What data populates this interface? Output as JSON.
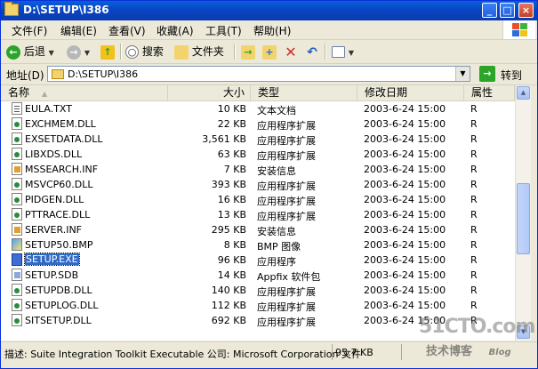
{
  "window": {
    "title": "D:\\SETUP\\I386"
  },
  "menu": [
    "文件(F)",
    "编辑(E)",
    "查看(V)",
    "收藏(A)",
    "工具(T)",
    "帮助(H)"
  ],
  "toolbar": {
    "back": "后退",
    "search": "搜索",
    "folders": "文件夹"
  },
  "address": {
    "label": "地址(D)",
    "path": "D:\\SETUP\\I386",
    "go": "转到"
  },
  "columns": {
    "name": "名称",
    "size": "大小",
    "type": "类型",
    "date": "修改日期",
    "attr": "属性"
  },
  "files": [
    {
      "name": "EULA.TXT",
      "size": "10 KB",
      "type": "文本文档",
      "date": "2003-6-24 15:00",
      "attr": "R",
      "icon": "txt"
    },
    {
      "name": "EXCHMEM.DLL",
      "size": "22 KB",
      "type": "应用程序扩展",
      "date": "2003-6-24 15:00",
      "attr": "R",
      "icon": "dll"
    },
    {
      "name": "EXSETDATA.DLL",
      "size": "3,561 KB",
      "type": "应用程序扩展",
      "date": "2003-6-24 15:00",
      "attr": "R",
      "icon": "dll"
    },
    {
      "name": "LIBXDS.DLL",
      "size": "63 KB",
      "type": "应用程序扩展",
      "date": "2003-6-24 15:00",
      "attr": "R",
      "icon": "dll"
    },
    {
      "name": "MSSEARCH.INF",
      "size": "7 KB",
      "type": "安装信息",
      "date": "2003-6-24 15:00",
      "attr": "R",
      "icon": "inf"
    },
    {
      "name": "MSVCP60.DLL",
      "size": "393 KB",
      "type": "应用程序扩展",
      "date": "2003-6-24 15:00",
      "attr": "R",
      "icon": "dll"
    },
    {
      "name": "PIDGEN.DLL",
      "size": "16 KB",
      "type": "应用程序扩展",
      "date": "2003-6-24 15:00",
      "attr": "R",
      "icon": "dll"
    },
    {
      "name": "PTTRACE.DLL",
      "size": "13 KB",
      "type": "应用程序扩展",
      "date": "2003-6-24 15:00",
      "attr": "R",
      "icon": "dll"
    },
    {
      "name": "SERVER.INF",
      "size": "295 KB",
      "type": "安装信息",
      "date": "2003-6-24 15:00",
      "attr": "R",
      "icon": "inf"
    },
    {
      "name": "SETUP50.BMP",
      "size": "8 KB",
      "type": "BMP 图像",
      "date": "2003-6-24 15:00",
      "attr": "R",
      "icon": "bmp"
    },
    {
      "name": "SETUP.EXE",
      "size": "96 KB",
      "type": "应用程序",
      "date": "2003-6-24 15:00",
      "attr": "R",
      "icon": "exe",
      "selected": true
    },
    {
      "name": "SETUP.SDB",
      "size": "14 KB",
      "type": "Appfix 软件包",
      "date": "2003-6-24 15:00",
      "attr": "R",
      "icon": "sdb"
    },
    {
      "name": "SETUPDB.DLL",
      "size": "140 KB",
      "type": "应用程序扩展",
      "date": "2003-6-24 15:00",
      "attr": "R",
      "icon": "dll"
    },
    {
      "name": "SETUPLOG.DLL",
      "size": "112 KB",
      "type": "应用程序扩展",
      "date": "2003-6-24 15:00",
      "attr": "R",
      "icon": "dll"
    },
    {
      "name": "SITSETUP.DLL",
      "size": "692 KB",
      "type": "应用程序扩展",
      "date": "2003-6-24 15:00",
      "attr": "R",
      "icon": "dll"
    }
  ],
  "status": {
    "description": "描述: Suite Integration Toolkit Executable 公司: Microsoft Corporation 文件",
    "size": "95.7 KB"
  },
  "watermark": {
    "site": "51CTO.com",
    "sub": "技术博客",
    "blog": "Blog"
  }
}
